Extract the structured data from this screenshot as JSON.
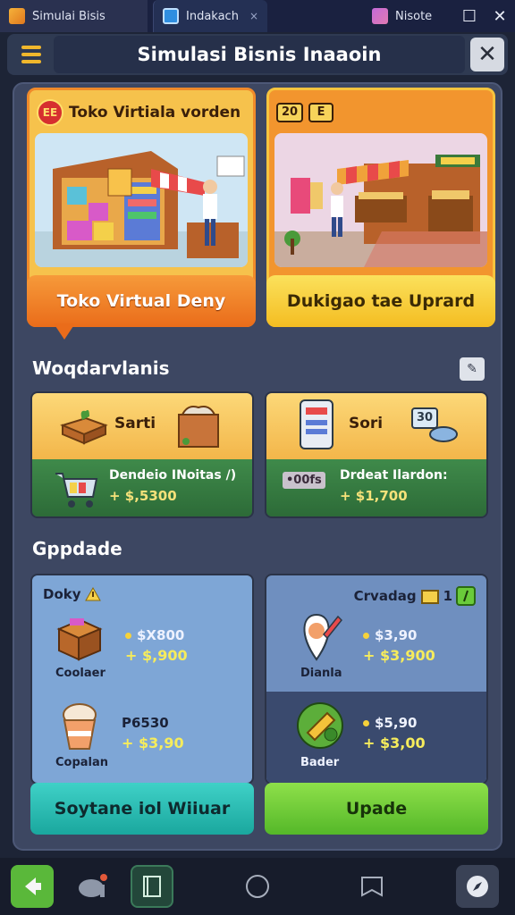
{
  "window": {
    "tabs": [
      {
        "label": "Simulai Bisis"
      },
      {
        "label": "Indakach",
        "close": "×"
      },
      {
        "label": "Nisote"
      }
    ],
    "maximize_glyph": "☐",
    "close_glyph": "✕"
  },
  "header": {
    "title": "Simulasi Bisnis Inaaoin",
    "close_glyph": "✕"
  },
  "stores": [
    {
      "seal": "EE",
      "heading": "Toko Virtiala vorden",
      "button": "Toko Virtual Deny"
    },
    {
      "badges": [
        "20",
        "E"
      ],
      "button": "Dukigao tae Uprard"
    }
  ],
  "products_section": {
    "title": "Woqdarvlanis",
    "edit_glyph": "✎",
    "cards": [
      {
        "label": "Sarti",
        "name": "Dendeio INoitas /)",
        "price": "+ $,5300"
      },
      {
        "label": "Sori",
        "badge": "30",
        "name": "Drdeat Ilardon:",
        "tag": "•00fs",
        "price": "+ $1,700"
      }
    ]
  },
  "upgrade_section": {
    "title": "Gppdade",
    "cards": [
      {
        "heading": "Doky",
        "items": [
          {
            "name": "Coolaer",
            "price_top": "$X800",
            "price_bottom": "+ $,900"
          },
          {
            "name": "Copalan",
            "price_top": "P6530",
            "price_bottom": "+ $3,90"
          }
        ]
      },
      {
        "heading": "Crvadag",
        "count": "1",
        "items": [
          {
            "name": "Dianla",
            "price_top": "$3,90",
            "price_bottom": "+ $3,900"
          },
          {
            "name": "Bader",
            "price_top": "$5,90",
            "price_bottom": "+ $3,00"
          }
        ]
      }
    ],
    "buttons": [
      "Soytane iol Wiiuar",
      "Upade"
    ]
  },
  "colors": {
    "accent_orange": "#ea6c1a",
    "accent_yellow": "#f4bd22",
    "panel": "#3d4762",
    "green_button": "#55b829",
    "teal_button": "#1aa79e"
  },
  "icons": {
    "nav": [
      "back-arrow-icon",
      "elephant-icon",
      "book-icon",
      "home-circle-icon",
      "bookmark-icon",
      "compass-icon"
    ]
  }
}
